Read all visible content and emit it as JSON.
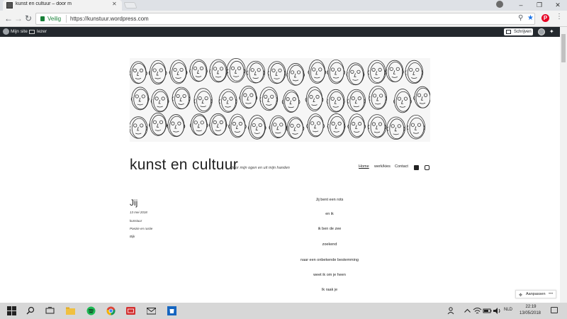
{
  "browser": {
    "tab_title": "kunst en cultuur – door m",
    "secure_label": "Veilig",
    "url": "https://kunstuur.wordpress.com",
    "win_minimize": "–",
    "win_maximize": "❐",
    "win_close": "✕",
    "back": "←",
    "forward": "→",
    "reload": "↻",
    "menu": "⋮",
    "star": "★"
  },
  "adminbar": {
    "my_site": "Mijn site",
    "reader": "lezer",
    "write": "Schrijven"
  },
  "site": {
    "title": "kunst en cultuur",
    "tagline": "door mijn ogen en uit mijn handen",
    "nav": [
      "Home",
      "werk/kies",
      "Contact"
    ]
  },
  "post": {
    "title": "Jij",
    "meta": [
      "13 mei 2018",
      "kunstuur",
      "Poezie en rustie",
      "Bijk"
    ],
    "lines": [
      "Jij bent een rots",
      "en ik",
      "ik ben de zee",
      "zoekend",
      "naar een onbekende bestemming",
      "weet ik om je heen",
      "Ik raak je"
    ]
  },
  "customize": {
    "label": "Aanpassen",
    "dots": "•••"
  },
  "taskbar": {
    "lang": "NLD",
    "time": "22:19",
    "date": "13/05/2018"
  },
  "colors": {
    "adminbar": "#23282d",
    "secure": "#188038",
    "pinterest": "#e60023"
  }
}
